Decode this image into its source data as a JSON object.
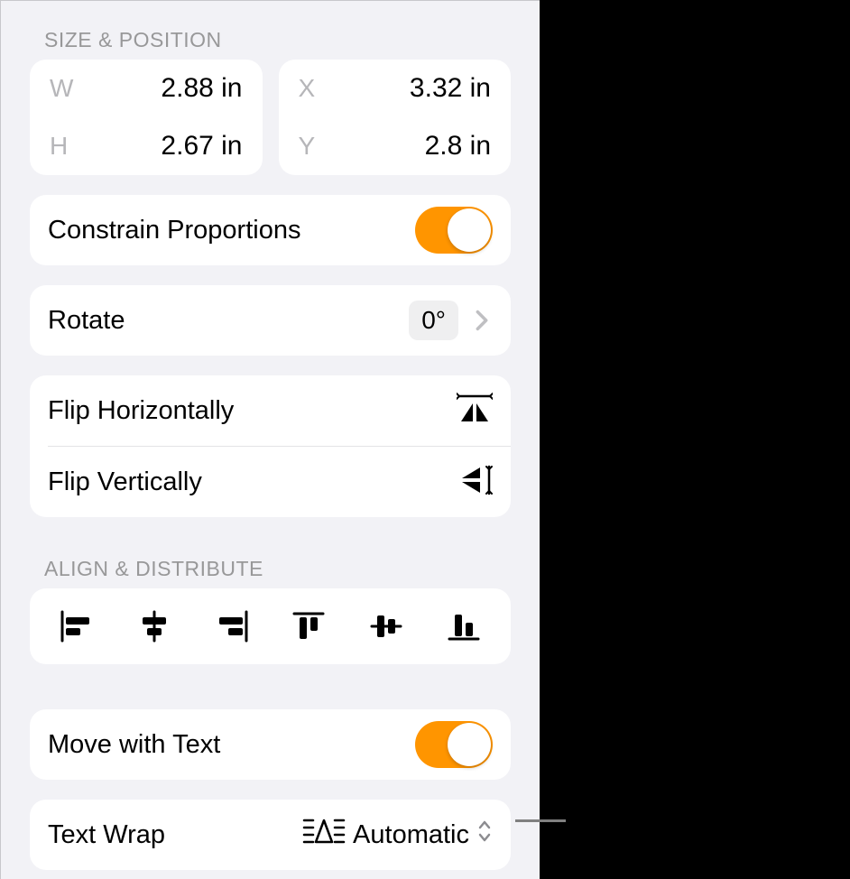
{
  "sections": {
    "size_position_header": "SIZE & POSITION",
    "align_distribute_header": "ALIGN & DISTRIBUTE"
  },
  "size": {
    "w_label": "W",
    "w_value": "2.88 in",
    "h_label": "H",
    "h_value": "2.67 in",
    "x_label": "X",
    "x_value": "3.32 in",
    "y_label": "Y",
    "y_value": "2.8 in"
  },
  "constrain": {
    "label": "Constrain Proportions",
    "on": true
  },
  "rotate": {
    "label": "Rotate",
    "value": "0°"
  },
  "flip": {
    "horizontal_label": "Flip Horizontally",
    "vertical_label": "Flip Vertically"
  },
  "move_with_text": {
    "label": "Move with Text",
    "on": true
  },
  "text_wrap": {
    "label": "Text Wrap",
    "value": "Automatic"
  }
}
